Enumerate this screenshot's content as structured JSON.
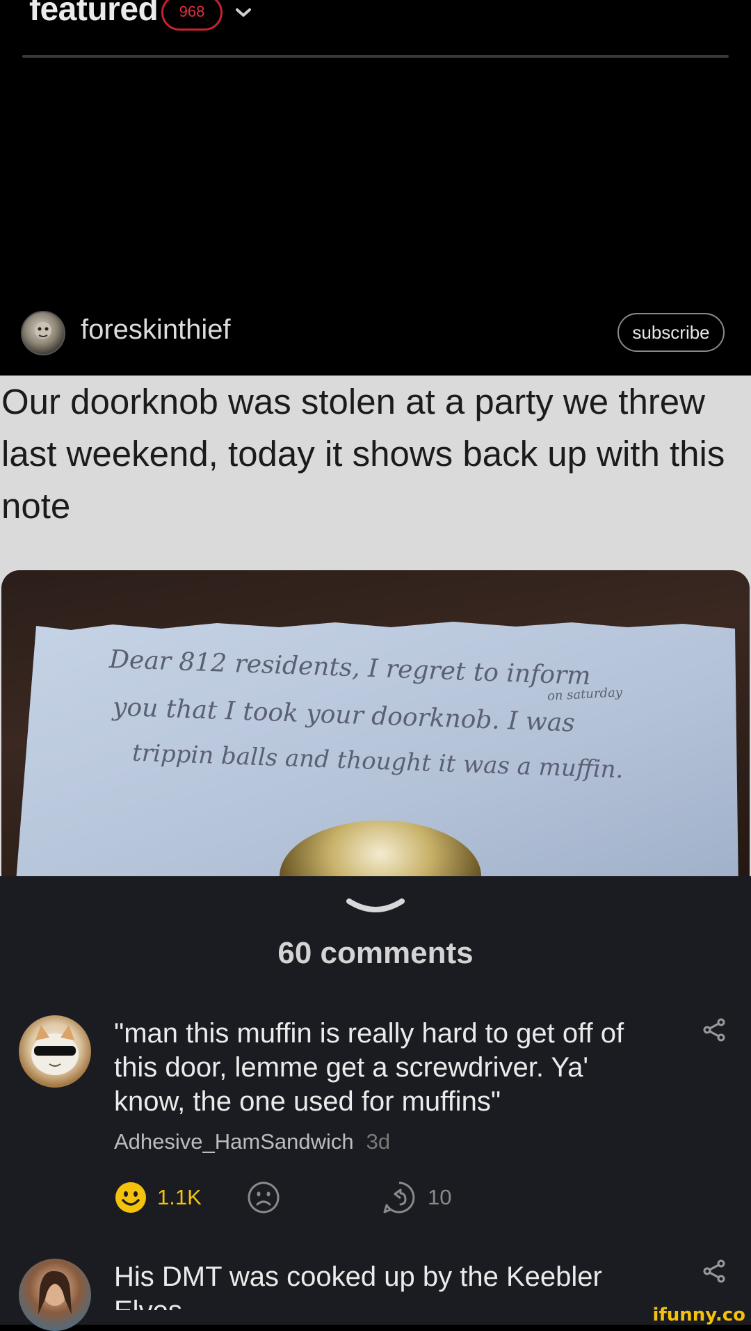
{
  "header": {
    "title": "featured",
    "badge_count": "968"
  },
  "post": {
    "author": "foreskinthief",
    "subscribe_label": "subscribe",
    "caption": "Our doorknob was stolen at a party we threw last weekend, today it shows back up with this note",
    "note_lines": [
      "Dear 812 residents, I regret to inform",
      "you that I took your doorknob. I was",
      "trippin balls and thought it was a muffin."
    ],
    "note_insert": "on saturday"
  },
  "comments": {
    "title": "60 comments",
    "items": [
      {
        "text": "\"man this muffin is really hard to get off of this door, lemme get a screwdriver. Ya' know, the one used for muffins\"",
        "author": "Adhesive_HamSandwich",
        "time": "3d",
        "likes": "1.1K",
        "replies": "10"
      },
      {
        "text": "His DMT was cooked up by the Keebler Elves"
      }
    ]
  },
  "watermark": "ifunny.co",
  "colors": {
    "accent_red": "#c4232f",
    "like_yellow": "#f4c20d",
    "comments_bg": "#1b1c21"
  }
}
